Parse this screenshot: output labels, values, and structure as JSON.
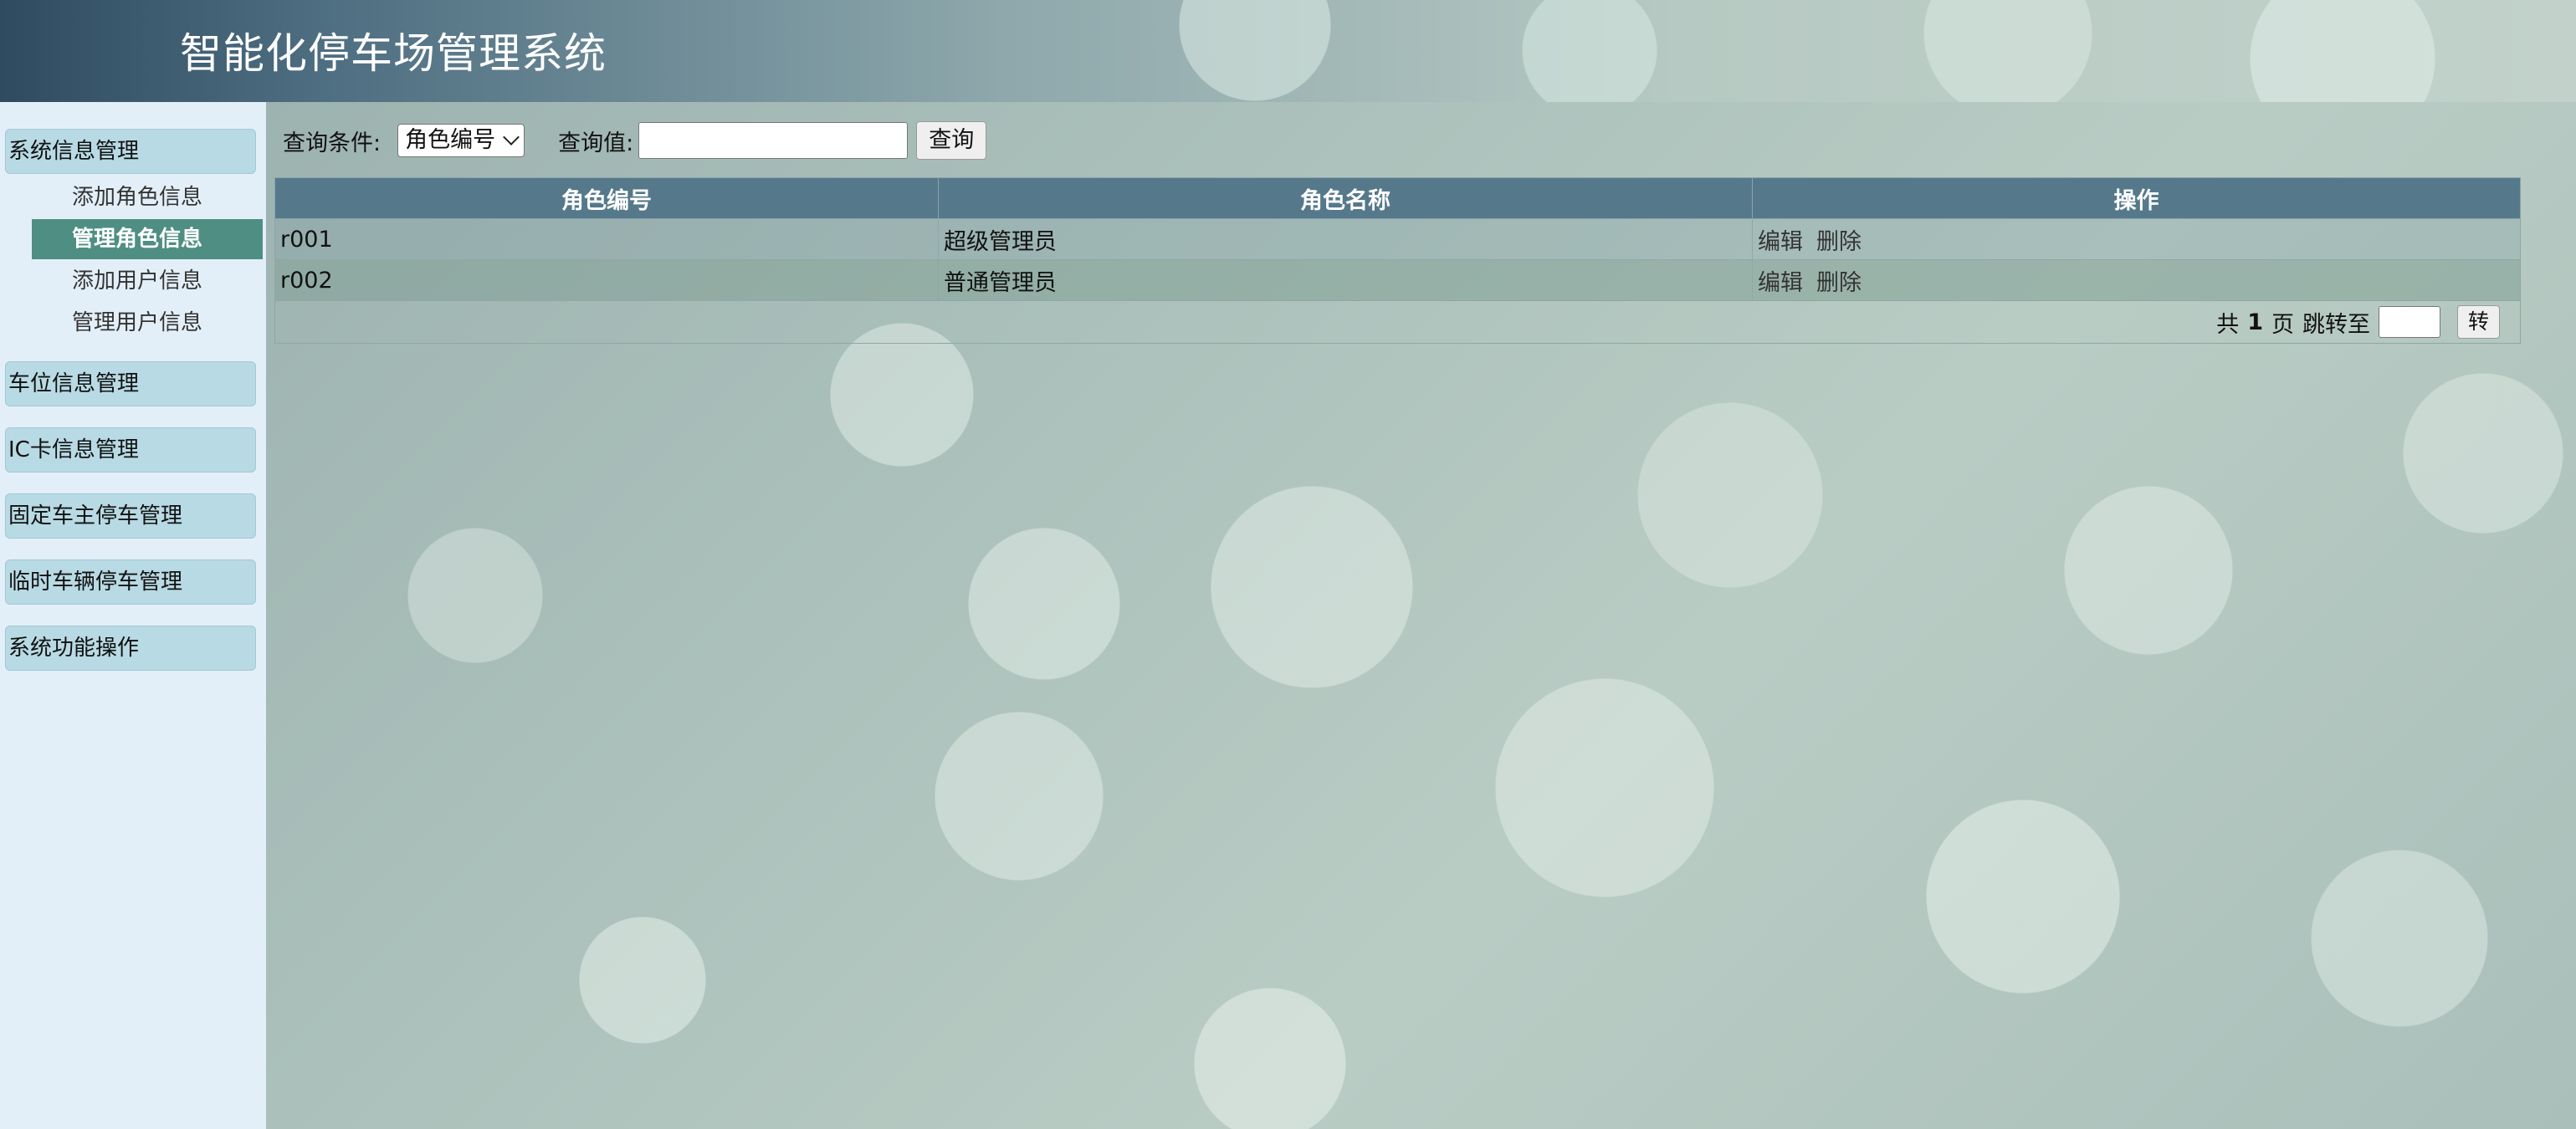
{
  "header": {
    "title": "智能化停车场管理系统"
  },
  "sidebar": {
    "groups": [
      {
        "label": "系统信息管理"
      },
      {
        "label": "车位信息管理"
      },
      {
        "label": "IC卡信息管理"
      },
      {
        "label": "固定车主停车管理"
      },
      {
        "label": "临时车辆停车管理"
      },
      {
        "label": "系统功能操作"
      }
    ],
    "submenu": [
      {
        "label": "添加角色信息"
      },
      {
        "label": "管理角色信息",
        "active": true
      },
      {
        "label": "添加用户信息"
      },
      {
        "label": "管理用户信息"
      }
    ]
  },
  "search": {
    "condition_label": "查询条件:",
    "condition_selected": "角色编号",
    "value_label": "查询值:",
    "value": "",
    "button_label": "查询"
  },
  "table": {
    "columns": [
      "角色编号",
      "角色名称",
      "操作"
    ],
    "rows": [
      {
        "id": "r001",
        "name": "超级管理员",
        "edit": "编辑",
        "delete": "删除"
      },
      {
        "id": "r002",
        "name": "普通管理员",
        "edit": "编辑",
        "delete": "删除"
      }
    ]
  },
  "pagination": {
    "total_prefix": "共",
    "total_pages": "1",
    "total_suffix": "页",
    "jump_label": "跳转至",
    "jump_value": "",
    "go_label": "转"
  },
  "colors": {
    "sidebar_bg": "#e3eff8",
    "menu_group_bg": "#b8dae4",
    "active_item_bg": "#4f8e83",
    "table_header_bg": "#55798b"
  }
}
